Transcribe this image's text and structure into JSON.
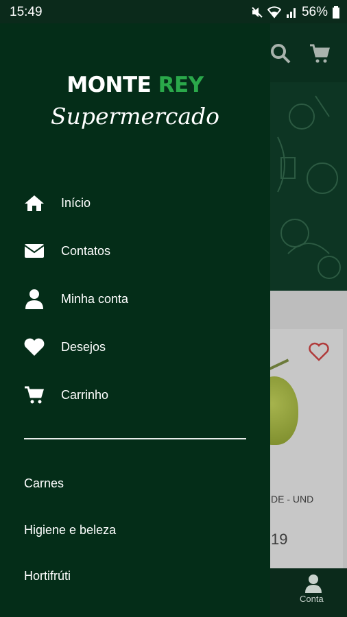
{
  "status_bar": {
    "time": "15:49",
    "battery": "56%"
  },
  "drawer": {
    "brand": {
      "part1": "MONTE ",
      "part2": "REY",
      "subtitle": "Supermercado"
    },
    "menu": [
      {
        "label": "Início",
        "icon": "home-icon"
      },
      {
        "label": "Contatos",
        "icon": "mail-icon"
      },
      {
        "label": "Minha conta",
        "icon": "user-icon"
      },
      {
        "label": "Desejos",
        "icon": "heart-icon"
      },
      {
        "label": "Carrinho",
        "icon": "cart-icon"
      }
    ],
    "categories": [
      "Carnes",
      "Higiene e beleza",
      "Hortifrúti"
    ]
  },
  "background_app": {
    "product_name": "DE - UND",
    "price": "19",
    "bottom_nav_label": "Conta"
  },
  "colors": {
    "drawer_bg": "#042d18",
    "accent_green": "#2aa84a",
    "wishlist_red": "#c0392b"
  }
}
